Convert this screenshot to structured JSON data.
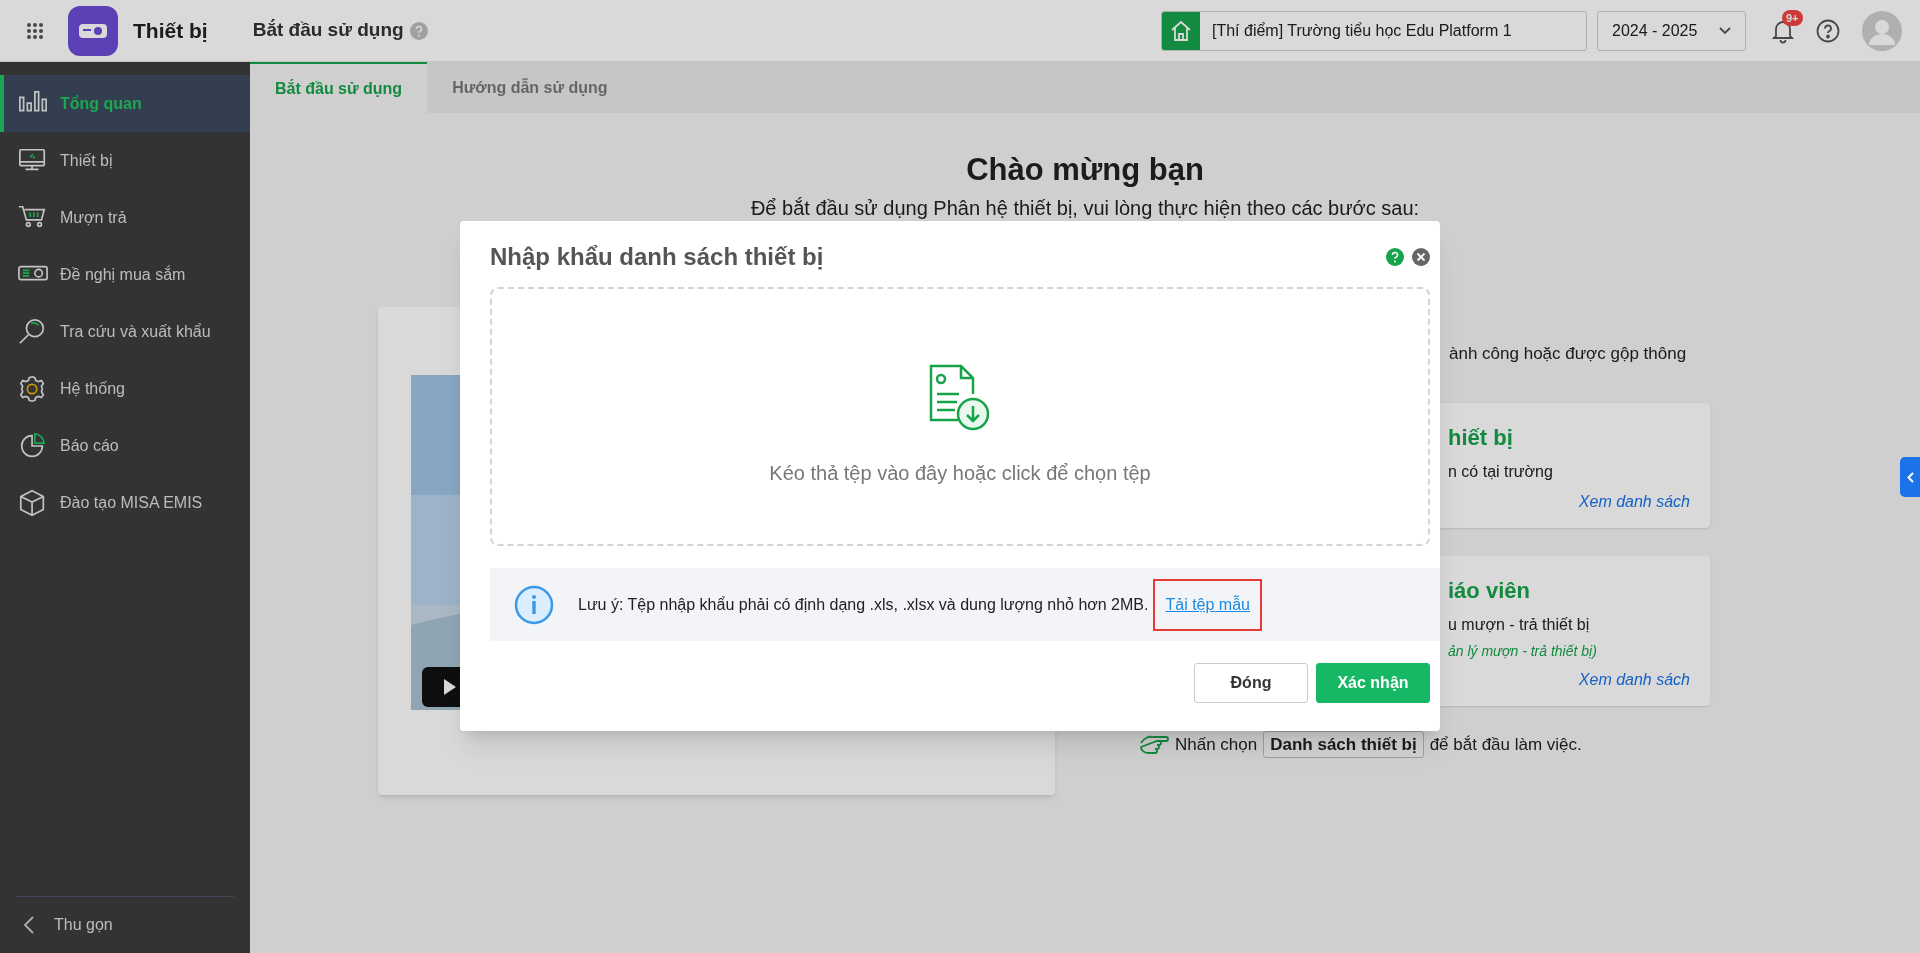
{
  "app": {
    "title": "Thiết bị"
  },
  "header": {
    "page_title": "Bắt đầu sử dụng",
    "school": "[Thí điểm] Trường tiểu học Edu Platform 1",
    "school_year": "2024 - 2025",
    "notification_count": "9+"
  },
  "sidebar": {
    "items": [
      {
        "label": "Tổng quan",
        "selected": true
      },
      {
        "label": "Thiết bị",
        "selected": false
      },
      {
        "label": "Mượn trả",
        "selected": false
      },
      {
        "label": "Đề nghị mua sắm",
        "selected": false
      },
      {
        "label": "Tra cứu và xuất khẩu",
        "selected": false
      },
      {
        "label": "Hệ thống",
        "selected": false
      },
      {
        "label": "Báo cáo",
        "selected": false
      },
      {
        "label": "Đào tạo MISA EMIS",
        "selected": false
      }
    ],
    "collapse": "Thu gọn"
  },
  "tabs": [
    {
      "label": "Bắt đầu sử dụng",
      "selected": true
    },
    {
      "label": "Hướng dẫn sử dụng",
      "selected": false
    }
  ],
  "welcome": {
    "title": "Chào mừng bạn",
    "subtitle": "Để bắt đầu sử dụng Phân hệ thiết bị, vui lòng thực hiện theo các bước sau:",
    "note_fragment": "ành công hoặc được gộp thông",
    "cards": [
      {
        "title": "hiết bị",
        "text": "n có tại trường",
        "link": "Xem danh sách"
      },
      {
        "title": "iáo viên",
        "text": "u mượn - trả thiết bị",
        "hint": "ản lý mượn - trả thiết bị)",
        "link": "Xem danh sách"
      }
    ],
    "action": {
      "before": "Nhấn chọn",
      "button": "Danh sách thiết bị",
      "after": "để bắt đầu làm việc."
    }
  },
  "dialog": {
    "title": "Nhập khẩu danh sách thiết bị",
    "dropzone_text": "Kéo thả tệp vào đây hoặc click để chọn tệp",
    "note": "Lưu ý: Tệp nhập khẩu phải có định dạng .xls, .xlsx và dung lượng nhỏ hơn 2MB.",
    "template_link": "Tải tệp mẫu",
    "link_highlighted": true,
    "buttons": [
      {
        "label": "Đóng",
        "kind": "secondary"
      },
      {
        "label": "Xác nhận",
        "kind": "primary"
      }
    ]
  }
}
